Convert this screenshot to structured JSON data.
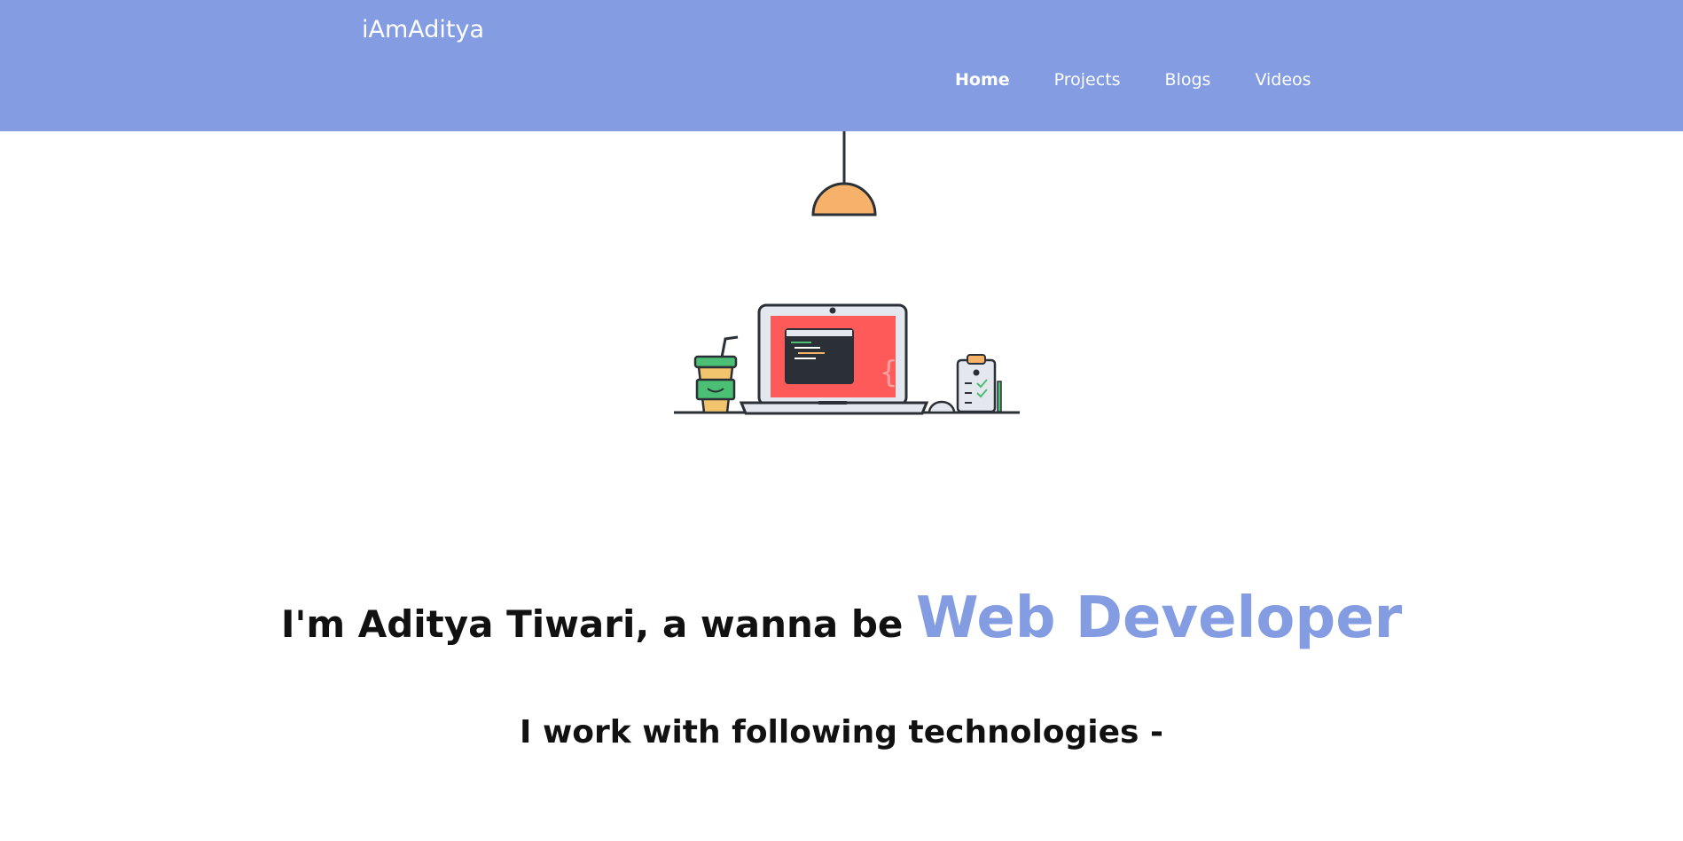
{
  "brand": {
    "name": "iAmAditya"
  },
  "nav": {
    "items": [
      {
        "label": "Home",
        "active": true
      },
      {
        "label": "Projects"
      },
      {
        "label": "Blogs"
      },
      {
        "label": "Videos"
      }
    ]
  },
  "hero": {
    "headline_prefix": "I'm Aditya Tiwari, a wanna be",
    "headline_role": "Web Developer",
    "subheading": "I work with following technologies -"
  },
  "colors": {
    "accent": "#839ce2",
    "lamp": "#f6b26b",
    "screen": "#ff5a5a",
    "cup": "#4bbf73",
    "dark": "#2b2f36"
  },
  "icons": [
    "lamp-icon",
    "coffee-cup-icon",
    "laptop-icon",
    "mouse-icon",
    "clipboard-icon"
  ]
}
